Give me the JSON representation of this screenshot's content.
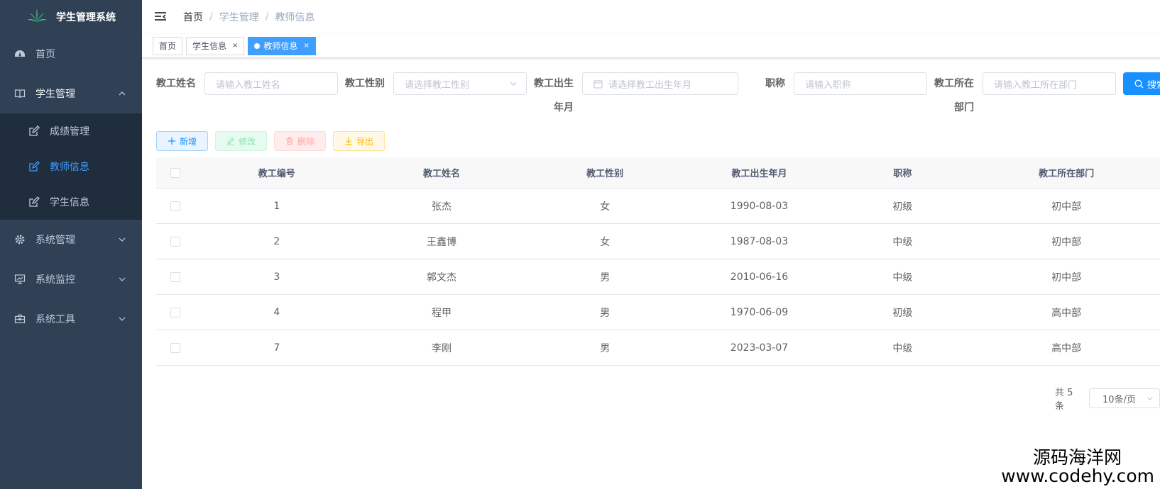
{
  "sidebar": {
    "title": "学生管理系统",
    "items": [
      {
        "label": "首页"
      },
      {
        "label": "学生管理"
      },
      {
        "label": "成绩管理"
      },
      {
        "label": "教师信息"
      },
      {
        "label": "学生信息"
      },
      {
        "label": "系统管理"
      },
      {
        "label": "系统监控"
      },
      {
        "label": "系统工具"
      }
    ]
  },
  "breadcrumb": [
    "首页",
    "学生管理",
    "教师信息"
  ],
  "tags": [
    {
      "label": "首页"
    },
    {
      "label": "学生信息"
    },
    {
      "label": "教师信息"
    }
  ],
  "search": {
    "name_label": "教工姓名",
    "name_placeholder": "请输入教工姓名",
    "sex_label": "教工性别",
    "sex_placeholder": "请选择教工性别",
    "birth_label_1": "教工出生",
    "birth_label_2": "年月",
    "birth_placeholder": "请选择教工出生年月",
    "title_label": "职称",
    "title_placeholder": "请输入职称",
    "dept_label_1": "教工所在",
    "dept_label_2": "部门",
    "dept_placeholder": "请输入教工所在部门",
    "search_button": "搜索"
  },
  "toolbar": {
    "add": "新增",
    "edit": "修改",
    "delete": "删除",
    "export": "导出"
  },
  "table": {
    "headers": [
      "教工编号",
      "教工姓名",
      "教工性别",
      "教工出生年月",
      "职称",
      "教工所在部门"
    ],
    "rows": [
      [
        "1",
        "张杰",
        "女",
        "1990-08-03",
        "初级",
        "初中部"
      ],
      [
        "2",
        "王鑫博",
        "女",
        "1987-08-03",
        "中级",
        "初中部"
      ],
      [
        "3",
        "郭文杰",
        "男",
        "2010-06-16",
        "中级",
        "初中部"
      ],
      [
        "4",
        "程甲",
        "男",
        "1970-06-09",
        "初级",
        "高中部"
      ],
      [
        "7",
        "李刚",
        "男",
        "2023-03-07",
        "中级",
        "高中部"
      ]
    ]
  },
  "pagination": {
    "total": "共 5 条",
    "page_size": "10条/页"
  },
  "watermark": {
    "cn": "源码海洋网",
    "url": "www.codehy.com"
  },
  "colors": {
    "sidebar_bg": "#304156",
    "submenu_bg": "#1f2d3d",
    "primary": "#1890ff",
    "active_tag": "#409eff"
  }
}
